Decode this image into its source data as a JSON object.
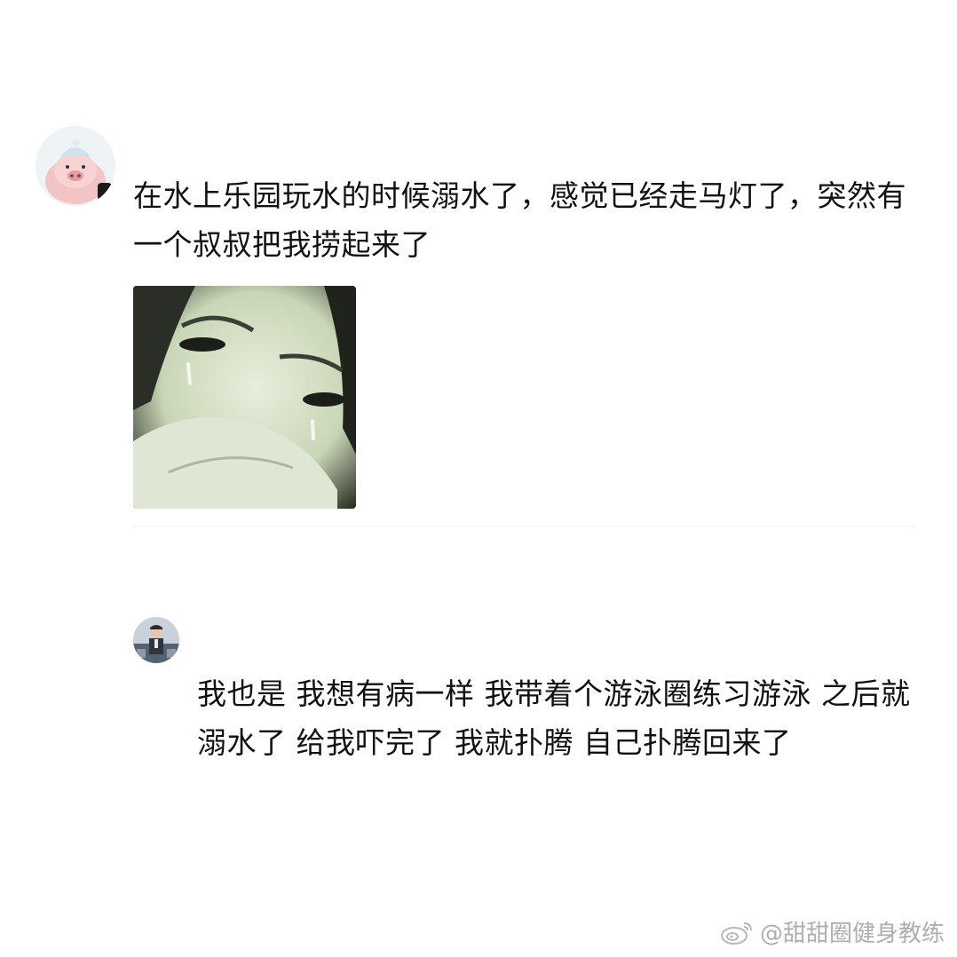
{
  "comments": [
    {
      "text": "在水上乐园玩水的时候溺水了，感觉已经走马灯了，突然有一个叔叔把我捞起来了",
      "avatar_icon": "pig-avatar-icon",
      "sticker_icon": "crying-face-sticker"
    },
    {
      "text": "我也是 我想有病一样 我带着个游泳圈练习游泳 之后就溺水了 给我吓完了 我就扑腾 自己扑腾回来了",
      "avatar_icon": "person-avatar-icon"
    }
  ],
  "watermark": {
    "icon": "weibo-icon",
    "text": "@甜甜圈健身教练"
  },
  "colors": {
    "background": "#ffffff",
    "text": "#111111",
    "watermark": "#a0a0a0"
  }
}
